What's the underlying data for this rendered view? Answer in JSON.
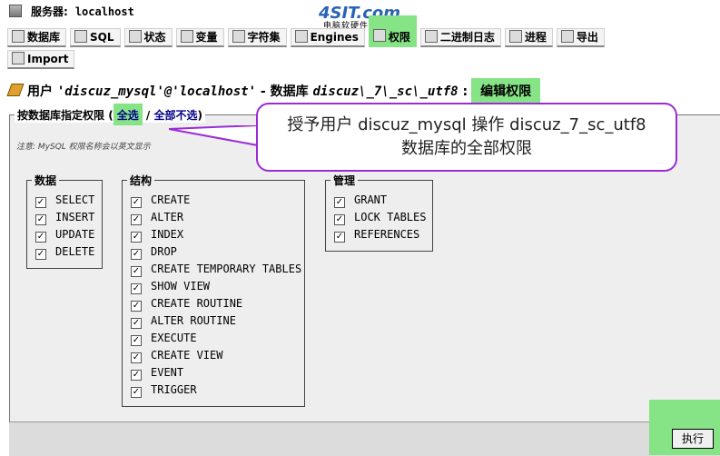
{
  "server": {
    "label": "服务器:",
    "value": "localhost"
  },
  "logo": {
    "main": "4SIT.com",
    "sub": "电脑软硬件应用网"
  },
  "tabs": [
    {
      "label": "数据库",
      "icon": "database-icon",
      "active": false
    },
    {
      "label": "SQL",
      "icon": "sql-icon",
      "active": false
    },
    {
      "label": "状态",
      "icon": "status-icon",
      "active": false
    },
    {
      "label": "变量",
      "icon": "variables-icon",
      "active": false
    },
    {
      "label": "字符集",
      "icon": "charset-icon",
      "active": false
    },
    {
      "label": "Engines",
      "icon": "engines-icon",
      "active": false
    },
    {
      "label": "权限",
      "icon": "privileges-icon",
      "active": true
    },
    {
      "label": "二进制日志",
      "icon": "binlog-icon",
      "active": false
    },
    {
      "label": "进程",
      "icon": "process-icon",
      "active": false
    },
    {
      "label": "导出",
      "icon": "export-icon",
      "active": false
    },
    {
      "label": "Import",
      "icon": "import-icon",
      "active": false
    }
  ],
  "heading": {
    "user_label": "用户",
    "user_value": "'discuz_mysql'@'localhost'",
    "dash": " - ",
    "db_label": "数据库",
    "db_value": "discuz\\_7\\_sc\\_utf8",
    "colon": ":",
    "edit_label": "编辑权限"
  },
  "fieldset": {
    "legend": "按数据库指定权限",
    "select_all": "全选",
    "separator": "/",
    "deselect_all": "全部不选",
    "note": "注意: MySQL 权限名称会以英文显示"
  },
  "callout": {
    "line1": "授予用户  discuz_mysql 操作  discuz_7_sc_utf8",
    "line2": "数据库的全部权限"
  },
  "groups": {
    "data": {
      "title": "数据",
      "items": [
        "SELECT",
        "INSERT",
        "UPDATE",
        "DELETE"
      ]
    },
    "structure": {
      "title": "结构",
      "items": [
        "CREATE",
        "ALTER",
        "INDEX",
        "DROP",
        "CREATE TEMPORARY TABLES",
        "SHOW VIEW",
        "CREATE ROUTINE",
        "ALTER ROUTINE",
        "EXECUTE",
        "CREATE VIEW",
        "EVENT",
        "TRIGGER"
      ]
    },
    "admin": {
      "title": "管理",
      "items": [
        "GRANT",
        "LOCK TABLES",
        "REFERENCES"
      ]
    }
  },
  "execute_label": "执行",
  "colors": {
    "highlight": "#86e386",
    "callout_border": "#9b2bd6",
    "link": "#00008b"
  }
}
